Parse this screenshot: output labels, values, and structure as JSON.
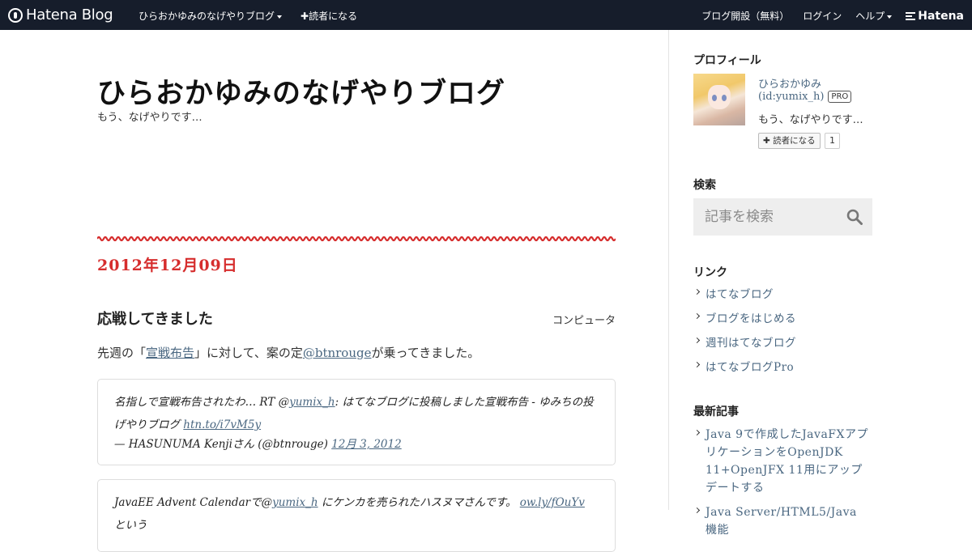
{
  "header": {
    "logo_text": "Hatena Blog",
    "blog_name": "ひらおかゆみのなげやりブログ",
    "subscribe": "読者になる",
    "open_blog": "ブログ開設（無料）",
    "login": "ログイン",
    "help": "ヘルプ",
    "hatena": "Hatena"
  },
  "blog": {
    "title": "ひらおかゆみのなげやりブログ",
    "description": "もう、なげやりです…"
  },
  "entry": {
    "date": "2012年12月09日",
    "title": "応戦してきました",
    "category": "コンピュータ",
    "body_pre": "先週の「",
    "body_link1": "宣戦布告",
    "body_mid": "」に対して、案の定",
    "body_link2": "@btnrouge",
    "body_post": "が乗ってきました。"
  },
  "tweets": [
    {
      "text_pre": "名指しで宣戦布告されたわ… RT @",
      "mention": "yumix_h",
      "text_post": ": はてなブログに投稿しました宣戦布告 - ゆみちの投げやりブログ ",
      "link": "htn.to/i7vM5y",
      "author": "— HASUNUMA Kenjiさん (@btnrouge) ",
      "date": "12月 3, 2012"
    },
    {
      "text_pre": "JavaEE Advent Calendarで@",
      "mention": "yumix_h",
      "text_post": " にケンカを売られたハスヌマさんです。 ",
      "link": "ow.ly/fOuYv",
      "tail": " という"
    }
  ],
  "sidebar": {
    "profile_heading": "プロフィール",
    "profile_name": "ひらおかゆみ",
    "profile_id": "(id:yumix_h)",
    "pro_badge": "PRO",
    "profile_desc": "もう、なげやりです…",
    "subscribe_label": "読者になる",
    "subscriber_count": "1",
    "search_heading": "検索",
    "search_placeholder": "記事を検索",
    "links_heading": "リンク",
    "links": [
      "はてなブログ",
      "ブログをはじめる",
      "週刊はてなブログ",
      "はてなブログPro"
    ],
    "recent_heading": "最新記事",
    "recent": [
      "Java 9で作成したJavaFXアプリケーションをOpenJDK 11+OpenJFX 11用にアップデートする",
      "Java Server/HTML5/Java 機能"
    ]
  },
  "colors": {
    "header_bg": "#161d2b",
    "accent_red": "#d62d2d",
    "link": "#4a6781"
  }
}
